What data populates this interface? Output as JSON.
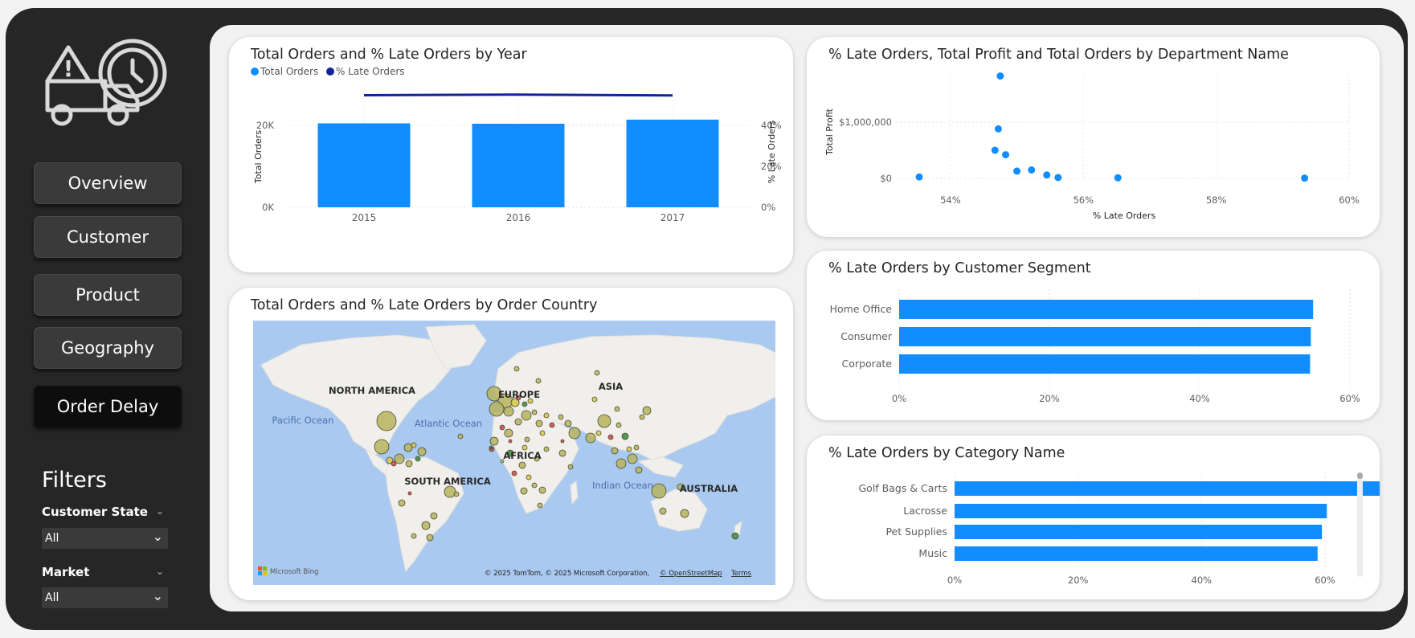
{
  "nav": {
    "items": [
      {
        "label": "Overview"
      },
      {
        "label": "Customer"
      },
      {
        "label": "Product"
      },
      {
        "label": "Geography"
      },
      {
        "label": "Order Delay"
      }
    ],
    "active": "Order Delay"
  },
  "filters": {
    "title": "Filters",
    "items": [
      {
        "label": "Customer State",
        "value": "All"
      },
      {
        "label": "Market",
        "value": "All"
      }
    ]
  },
  "colors": {
    "bar": "#118dff",
    "line": "#12239e",
    "accent_bg": "#262626"
  },
  "icons": [
    "delivery-truck-warning-clock-icon",
    "chevron-down-icon"
  ],
  "map": {
    "title": "Total Orders and % Late Orders by Order Country",
    "labels": {
      "north_america": "NORTH AMERICA",
      "south_america": "SOUTH AMERICA",
      "europe": "EUROPE",
      "africa": "AFRICA",
      "asia": "ASIA",
      "australia": "AUSTRALIA",
      "pacific_ocean": "Pacific Ocean",
      "atlantic_ocean": "Atlantic Ocean",
      "indian_ocean": "Indian Ocean"
    },
    "brand": "Microsoft Bing",
    "copyright": "© 2025 TomTom, © 2025 Microsoft Corporation,",
    "osm_link": "© OpenStreetMap",
    "terms_link": "Terms"
  },
  "chart_data": [
    {
      "type": "bar",
      "title": "Total Orders and % Late Orders by Year",
      "categories": [
        "2015",
        "2016",
        "2017"
      ],
      "series": [
        {
          "name": "Total Orders",
          "type": "bar",
          "axis": "left",
          "values": [
            20500,
            20400,
            21400
          ]
        },
        {
          "name": "% Late Orders",
          "type": "line",
          "axis": "right",
          "values": [
            0.547,
            0.55,
            0.546
          ]
        }
      ],
      "ylabel": "Total Orders",
      "y2label": "% Late Orders",
      "ylim": [
        0,
        20000
      ],
      "yticks": [
        "0K",
        "20K"
      ],
      "y2lim": [
        0,
        0.4
      ],
      "y2ticks": [
        "0%",
        "20%",
        "40%"
      ],
      "legend": "top-left",
      "grid": true
    },
    {
      "type": "scatter",
      "title": "% Late Orders, Total Profit and Total Orders by Department Name",
      "xlabel": "% Late Orders",
      "ylabel": "Total Profit",
      "xlim": [
        0.533,
        0.6
      ],
      "xticks": [
        "54%",
        "56%",
        "58%",
        "60%"
      ],
      "yticks": [
        "$0",
        "$1,000,000"
      ],
      "points": [
        {
          "x": 0.5353,
          "y": 25000
        },
        {
          "x": 0.5475,
          "y": 1820000
        },
        {
          "x": 0.5472,
          "y": 880000
        },
        {
          "x": 0.5467,
          "y": 500000
        },
        {
          "x": 0.5483,
          "y": 420000
        },
        {
          "x": 0.55,
          "y": 130000
        },
        {
          "x": 0.5522,
          "y": 150000
        },
        {
          "x": 0.5545,
          "y": 60000
        },
        {
          "x": 0.5562,
          "y": 15000
        },
        {
          "x": 0.5652,
          "y": 10000
        },
        {
          "x": 0.5933,
          "y": 5000
        }
      ],
      "grid": true
    },
    {
      "type": "bar",
      "orientation": "horizontal",
      "title": "% Late Orders by Customer Segment",
      "categories": [
        "Home Office",
        "Consumer",
        "Corporate"
      ],
      "values": [
        0.551,
        0.548,
        0.547
      ],
      "xlim": [
        0,
        0.6
      ],
      "xticks": [
        "0%",
        "20%",
        "40%",
        "60%"
      ],
      "grid": true
    },
    {
      "type": "bar",
      "orientation": "horizontal",
      "title": "% Late Orders by Category Name",
      "categories": [
        "Golf Bags & Carts",
        "Lacrosse",
        "Pet Supplies",
        "Music"
      ],
      "values": [
        0.691,
        0.603,
        0.595,
        0.588
      ],
      "xlim": [
        0,
        0.6
      ],
      "xticks": [
        "0%",
        "20%",
        "40%",
        "60%"
      ],
      "grid": true
    }
  ]
}
